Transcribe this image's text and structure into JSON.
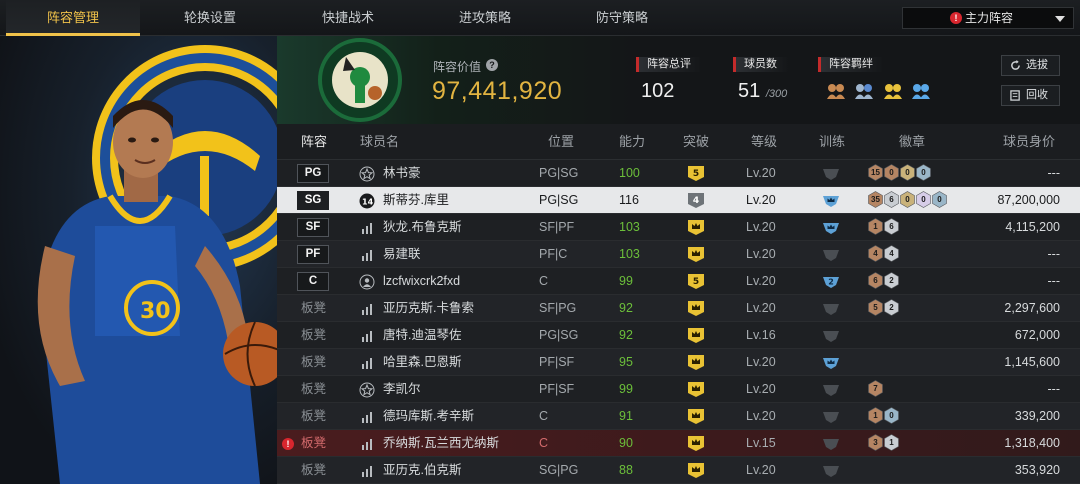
{
  "nav": {
    "tabs": [
      "阵容管理",
      "轮换设置",
      "快捷战术",
      "进攻策略",
      "防守策略"
    ],
    "active_index": 0,
    "lineup_select": "主力阵容"
  },
  "summary": {
    "value_label": "阵容价值",
    "value": "97,441,920",
    "overall_label": "阵容总评",
    "overall": "102",
    "count_label": "球员数",
    "count": "51",
    "count_max": "/300",
    "bond_label": "阵容羁绊",
    "select_button": "选拔",
    "recycle_button": "回收"
  },
  "table": {
    "headers": [
      "阵容",
      "球员名",
      "位置",
      "能力",
      "突破",
      "等级",
      "训练",
      "徽章",
      "球员身价"
    ],
    "rows": [
      {
        "slot": "PG",
        "bench": false,
        "icon": "star",
        "name": "林书豪",
        "pos": "PG|SG",
        "ability": "100",
        "brk": "5",
        "brk_style": "gold",
        "level": "Lv.20",
        "train": "",
        "badges": [
          {
            "t": "bronze",
            "n": "15"
          },
          {
            "t": "bronze",
            "n": "0"
          },
          {
            "t": "gold",
            "n": "0"
          },
          {
            "t": "blue",
            "n": "0"
          }
        ],
        "value": "---"
      },
      {
        "slot": "SG",
        "bench": false,
        "icon": "number14",
        "name": "斯蒂芬.库里",
        "pos": "PG|SG",
        "ability": "116",
        "brk": "4",
        "brk_style": "silver",
        "level": "Lv.20",
        "train": "crown",
        "badges": [
          {
            "t": "bronze",
            "n": "35"
          },
          {
            "t": "silver",
            "n": "6"
          },
          {
            "t": "gold",
            "n": "0"
          },
          {
            "t": "purple",
            "n": "0"
          },
          {
            "t": "blue",
            "n": "0"
          }
        ],
        "value": "87,200,000",
        "selected": true
      },
      {
        "slot": "SF",
        "bench": false,
        "icon": "bars",
        "name": "狄龙.布鲁克斯",
        "pos": "SF|PF",
        "ability": "103",
        "brk": "",
        "brk_style": "crown",
        "level": "Lv.20",
        "train": "crown",
        "badges": [
          {
            "t": "bronze",
            "n": "1"
          },
          {
            "t": "silver",
            "n": "6"
          }
        ],
        "value": "4,115,200"
      },
      {
        "slot": "PF",
        "bench": false,
        "icon": "bars",
        "name": "易建联",
        "pos": "PF|C",
        "ability": "103",
        "brk": "",
        "brk_style": "crown",
        "level": "Lv.20",
        "train": "",
        "badges": [
          {
            "t": "bronze",
            "n": "4"
          },
          {
            "t": "silver",
            "n": "4"
          }
        ],
        "value": "---"
      },
      {
        "slot": "C",
        "bench": false,
        "icon": "person",
        "name": "lzcfwixcrk2fxd",
        "pos": "C",
        "ability": "99",
        "brk": "5",
        "brk_style": "gold",
        "level": "Lv.20",
        "train": "2",
        "badges": [
          {
            "t": "bronze",
            "n": "6"
          },
          {
            "t": "silver",
            "n": "2"
          }
        ],
        "value": "---"
      },
      {
        "slot": "板凳",
        "bench": true,
        "icon": "bars",
        "name": "亚历克斯.卡鲁索",
        "pos": "SF|PG",
        "ability": "92",
        "brk": "",
        "brk_style": "crown",
        "level": "Lv.20",
        "train": "",
        "badges": [
          {
            "t": "bronze",
            "n": "5"
          },
          {
            "t": "silver",
            "n": "2"
          }
        ],
        "value": "2,297,600"
      },
      {
        "slot": "板凳",
        "bench": true,
        "icon": "bars",
        "name": "唐特.迪温琴佐",
        "pos": "PG|SG",
        "ability": "92",
        "brk": "",
        "brk_style": "crown",
        "level": "Lv.16",
        "train": "",
        "badges": [],
        "value": "672,000"
      },
      {
        "slot": "板凳",
        "bench": true,
        "icon": "bars",
        "name": "哈里森.巴恩斯",
        "pos": "PF|SF",
        "ability": "95",
        "brk": "",
        "brk_style": "crown",
        "level": "Lv.20",
        "train": "crown",
        "badges": [],
        "value": "1,145,600"
      },
      {
        "slot": "板凳",
        "bench": true,
        "icon": "star",
        "name": "李凯尔",
        "pos": "PF|SF",
        "ability": "99",
        "brk": "",
        "brk_style": "crown",
        "level": "Lv.20",
        "train": "",
        "badges": [
          {
            "t": "bronze",
            "n": "7"
          }
        ],
        "value": "---"
      },
      {
        "slot": "板凳",
        "bench": true,
        "icon": "bars",
        "name": "德玛库斯.考辛斯",
        "pos": "C",
        "ability": "91",
        "brk": "",
        "brk_style": "crown",
        "level": "Lv.20",
        "train": "",
        "badges": [
          {
            "t": "bronze",
            "n": "1"
          },
          {
            "t": "blue",
            "n": "0"
          }
        ],
        "value": "339,200"
      },
      {
        "slot": "板凳",
        "bench": true,
        "icon": "bars",
        "name": "乔纳斯.瓦兰西尤纳斯",
        "pos": "C",
        "ability": "90",
        "brk": "",
        "brk_style": "crown",
        "level": "Lv.15",
        "train": "",
        "badges": [
          {
            "t": "bronze",
            "n": "3"
          },
          {
            "t": "silver",
            "n": "1"
          }
        ],
        "value": "1,318,400",
        "warning": true
      },
      {
        "slot": "板凳",
        "bench": true,
        "icon": "bars",
        "name": "亚历克.伯克斯",
        "pos": "SG|PG",
        "ability": "88",
        "brk": "",
        "brk_style": "crown",
        "level": "Lv.20",
        "train": "",
        "badges": [],
        "value": "353,920"
      }
    ]
  },
  "colors": {
    "accent": "#f0c24a",
    "value_gold": "#e2b441",
    "ability_green": "#6cbf3a",
    "warning_red": "#d8262e"
  },
  "icons": {
    "help": "question-circle-icon",
    "select": "refresh-icon",
    "recycle": "recycle-icon",
    "warning": "exclamation-icon",
    "dropdown": "caret-down-icon"
  }
}
